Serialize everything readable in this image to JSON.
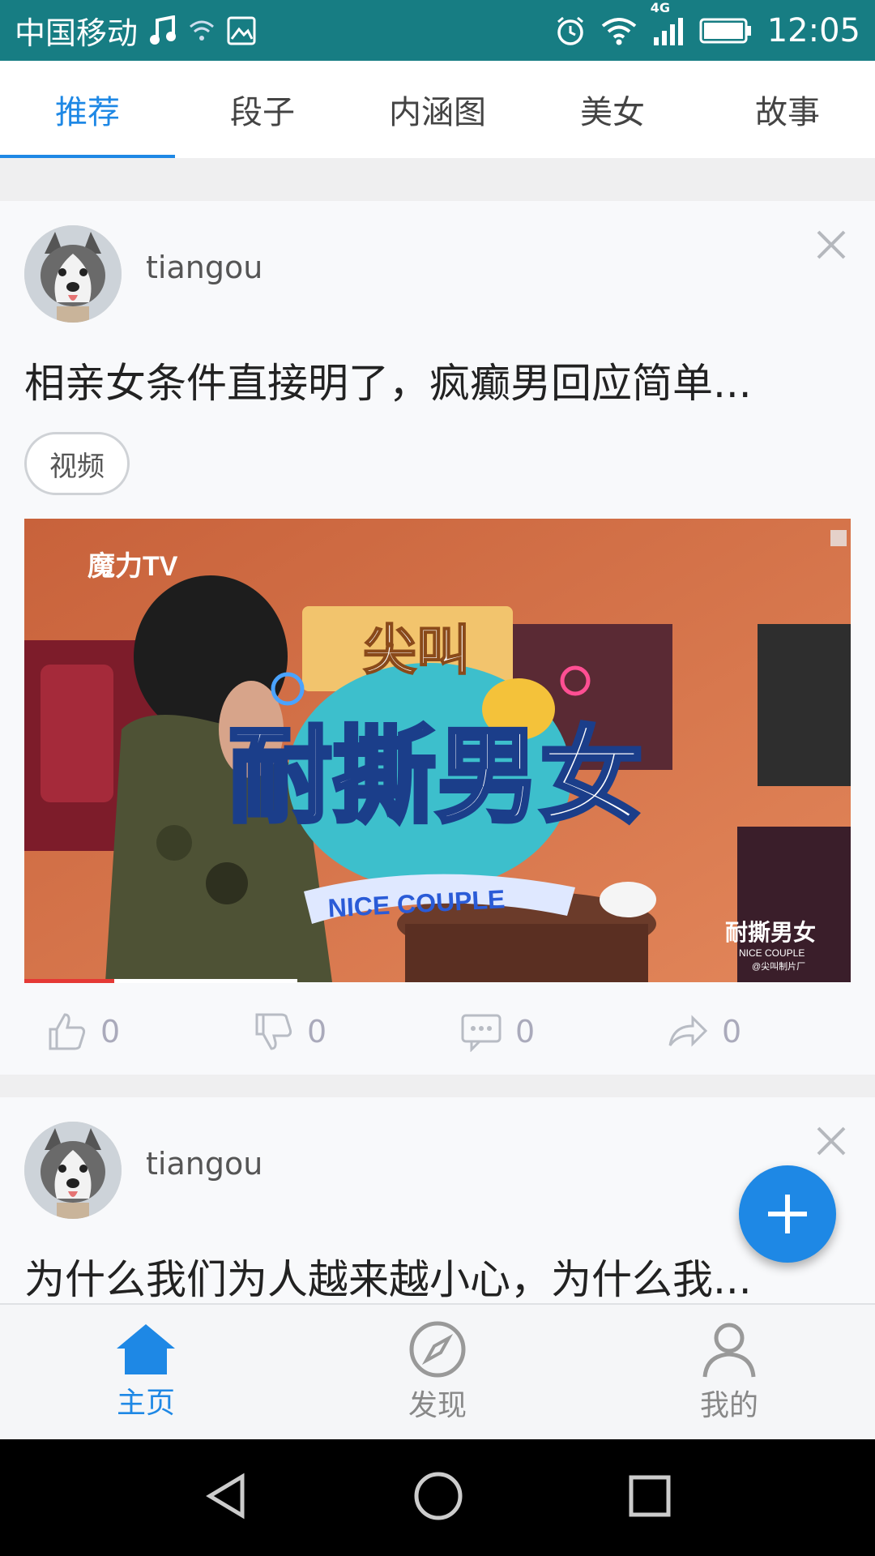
{
  "status_bar": {
    "carrier": "中国移动",
    "network": "4G",
    "time": "12:05"
  },
  "tabs": [
    {
      "label": "推荐",
      "active": true
    },
    {
      "label": "段子",
      "active": false
    },
    {
      "label": "内涵图",
      "active": false
    },
    {
      "label": "美女",
      "active": false
    },
    {
      "label": "故事",
      "active": false
    }
  ],
  "posts": [
    {
      "username": "tiangou",
      "title": "相亲女条件直接明了，疯癫男回应简单...",
      "tag": "视频",
      "video": {
        "watermark": "魔力TV",
        "logo_top": "尖叫",
        "logo_main": "耐撕男女",
        "logo_sub": "NICE COUPLE",
        "corner_title": "耐撕男女",
        "corner_sub": "NICE COUPLE",
        "corner_credit": "@尖叫制片厂",
        "progress": 0.33
      },
      "likes": "0",
      "dislikes": "0",
      "comments": "0",
      "shares": "0"
    },
    {
      "username": "tiangou",
      "title": "为什么我们为人越来越小心，为什么我..."
    }
  ],
  "bottom_nav": [
    {
      "label": "主页",
      "icon": "home-icon",
      "active": true
    },
    {
      "label": "发现",
      "icon": "compass-icon",
      "active": false
    },
    {
      "label": "我的",
      "icon": "user-icon",
      "active": false
    }
  ],
  "colors": {
    "status_bar": "#177d83",
    "accent": "#1e88e5"
  }
}
